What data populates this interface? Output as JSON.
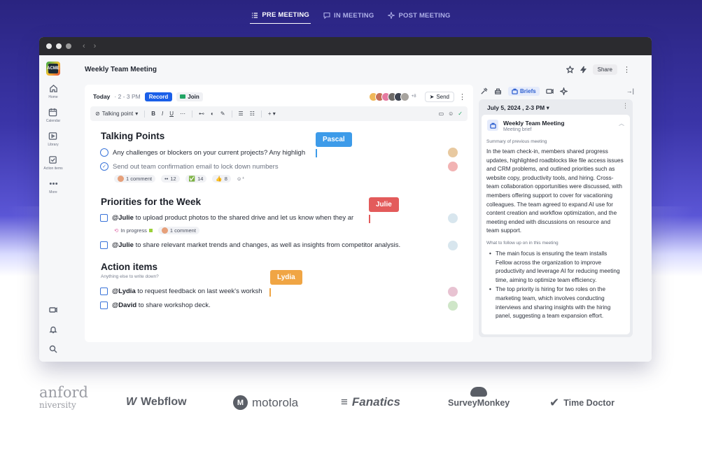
{
  "top_tabs": [
    {
      "label": "PRE MEETING",
      "active": true
    },
    {
      "label": "IN MEETING",
      "active": false
    },
    {
      "label": "POST MEETING",
      "active": false
    }
  ],
  "sidebar": {
    "logo_text": "ACME",
    "items": [
      {
        "label": "Home",
        "icon": "home-icon"
      },
      {
        "label": "Calendar",
        "icon": "calendar-icon",
        "badge": "30"
      },
      {
        "label": "Library",
        "icon": "library-icon"
      },
      {
        "label": "Action items",
        "icon": "checkbox-icon"
      },
      {
        "label": "More",
        "icon": "more-icon"
      }
    ]
  },
  "header": {
    "title": "Weekly Team Meeting",
    "share_label": "Share"
  },
  "doc": {
    "today_label": "Today",
    "time_label": "2 - 3 PM",
    "record_label": "Record",
    "join_label": "Join",
    "more_attendees": "+8",
    "send_label": "Send",
    "toolbar": {
      "style_label": "Talking point",
      "bold": "B",
      "italic": "I",
      "underline": "U"
    },
    "sections": {
      "talking_points": {
        "title": "Talking Points",
        "items": [
          "Any challenges or blockers on your current projects? Any highligh",
          "Send out team confirmation email to lock down numbers"
        ],
        "meta": {
          "comment": "1 comment",
          "eyes": "12",
          "check": "14",
          "thumbs": "8"
        }
      },
      "priorities": {
        "title": "Priorities for the Week",
        "item1_mention": "@Julie",
        "item1_text": "to upload product photos to the shared drive and let us know when they ar",
        "status": "In progress",
        "comment": "1 comment",
        "item2_mention": "@Julie",
        "item2_text": "to share relevant market trends and changes, as well as insights from competitor analysis."
      },
      "action_items": {
        "title": "Action items",
        "subtitle": "Anything else to write down?",
        "item1_mention": "@Lydia",
        "item1_text": "to request feedback on last week's worksh",
        "item2_mention": "@David",
        "item2_text": "to share workshop deck."
      }
    },
    "cursors": {
      "pascal": "Pascal",
      "julie": "Julie",
      "lydia": "Lydia"
    }
  },
  "brief": {
    "tab_label": "Briefs",
    "date_label": "July 5, 2024 , 2-3 PM",
    "card_title": "Weekly Team Meeting",
    "card_subtitle": "Meeting brief",
    "summary_label": "Summary of previous meeting",
    "summary_text": "In the team check-in, members shared progress updates, highlighted roadblocks like file access issues and CRM problems, and outlined priorities such as website copy, productivity tools, and hiring. Cross-team collaboration opportunities were discussed, with members offering support to cover for vacationing colleagues. The team agreed to expand AI use for content creation and workflow optimization, and the meeting ended with discussions on resource and team support.",
    "followup_label": "What to follow up on in this meeting",
    "followup_items": [
      "The main focus is ensuring the team installs Fellow across the organization to improve productivity and leverage AI for reducing meeting time, aiming to optimize team efficiency.",
      "The top priority is hiring for two roles on the marketing team, which involves conducting interviews and sharing insights with the hiring panel, suggesting a team expansion effort."
    ]
  },
  "logos": {
    "stanford_a": "anford",
    "stanford_b": "niversity",
    "webflow": "Webflow",
    "motorola": "motorola",
    "fanatics": "Fanatics",
    "surveymonkey": "SurveyMonkey",
    "timedoctor": "Time Doctor"
  },
  "colors": {
    "accent": "#1a5fe8",
    "pascal": "#3d9be9",
    "julie": "#e35b5b",
    "lydia": "#f0a544"
  }
}
